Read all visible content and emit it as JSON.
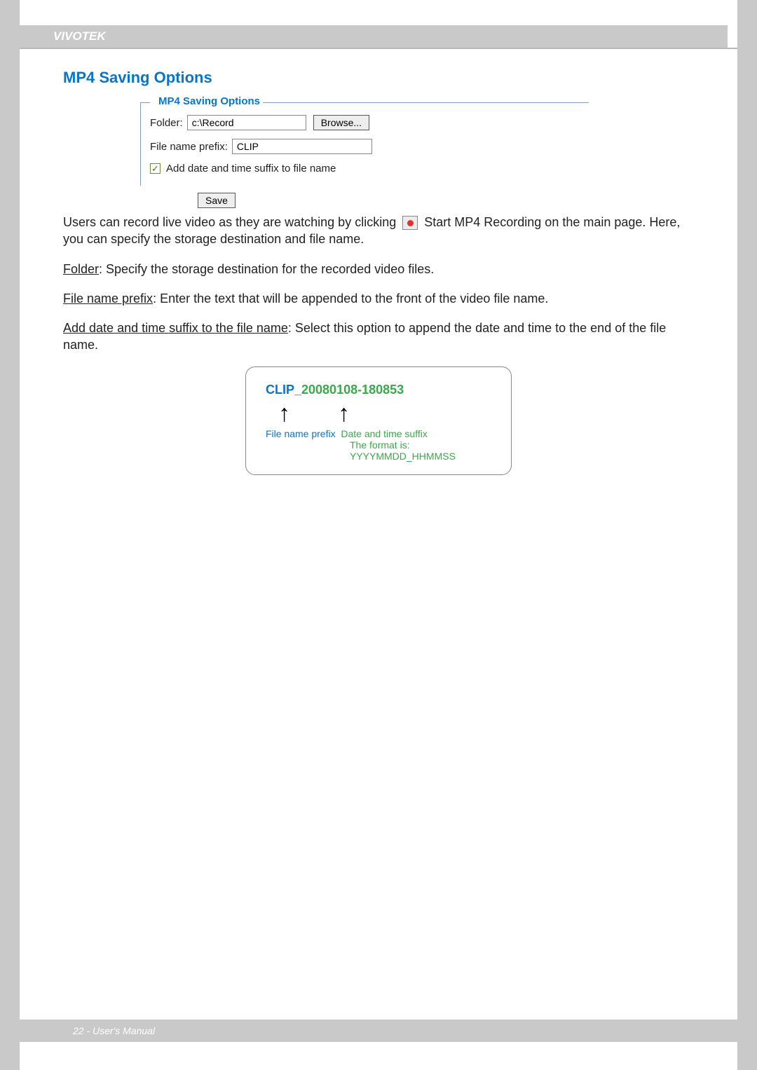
{
  "header": {
    "brand": "VIVOTEK"
  },
  "section": {
    "title": "MP4 Saving Options",
    "fieldset_legend": "MP4 Saving Options",
    "folder_label": "Folder:",
    "folder_value": "c:\\Record",
    "browse_label": "Browse...",
    "prefix_label": "File name prefix:",
    "prefix_value": "CLIP",
    "suffix_checkbox_label": "Add date and time suffix to file name",
    "suffix_checked": true,
    "save_label": "Save"
  },
  "body": {
    "intro_1a": "Users can record live video as they are watching by clicking ",
    "intro_1b": " Start MP4 Recording on the main page. Here, you can specify the storage destination and file name.",
    "folder_u": "Folder",
    "folder_text": ": Specify the storage destination for the recorded video files.",
    "prefix_u": "File name prefix",
    "prefix_text": ": Enter the text that will be appended to the front of the video file name.",
    "suffix_u": "Add date and time suffix to the file name",
    "suffix_text": ": Select this option to append the date and time to the end of the file name."
  },
  "diagram": {
    "prefix": "CLIP_",
    "suffix": "20080108-180853",
    "label_prefix": "File name prefix",
    "label_suffix": "Date and time suffix",
    "label_format": "The format is: YYYYMMDD_HHMMSS"
  },
  "footer": {
    "text": "22 - User's Manual"
  }
}
